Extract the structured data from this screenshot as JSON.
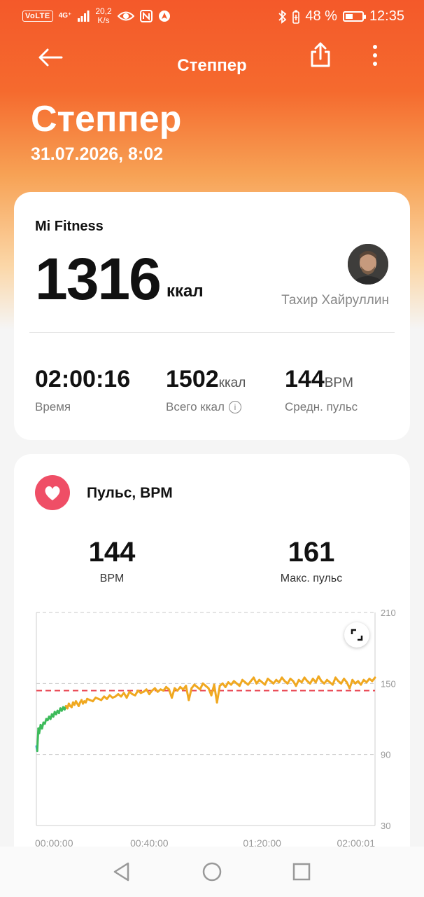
{
  "status_bar": {
    "volte": "VoLTE",
    "net_type": "4G⁺",
    "speed_value": "20,2",
    "speed_unit": "K/s",
    "battery_percent": "48 %",
    "battery_level": 0.48,
    "time": "12:35"
  },
  "app_bar": {
    "title": "Степпер"
  },
  "header": {
    "title": "Степпер",
    "date": "31.07.2026, 8:02"
  },
  "summary": {
    "source": "Mi Fitness",
    "calories": "1316",
    "calories_unit": "ккал",
    "user_name": "Тахир Хайруллин",
    "stats": [
      {
        "value": "02:00:16",
        "unit": "",
        "label": "Время"
      },
      {
        "value": "1502",
        "unit": "ккал",
        "label": "Всего ккал"
      },
      {
        "value": "144",
        "unit": "BPM",
        "label": "Средн. пульс"
      }
    ]
  },
  "pulse": {
    "title": "Пульс, BPM",
    "avg_value": "144",
    "avg_label": "BPM",
    "max_value": "161",
    "max_label": "Макс. пульс"
  },
  "colors": {
    "accent": "#f4592a",
    "heart": "#ef4e66",
    "line_blue": "#3fa9e0",
    "line_green": "#3dbb5a",
    "line_orange": "#f0a820",
    "avg_line": "#e8404c"
  },
  "chart_data": {
    "type": "line",
    "title": "Пульс, BPM",
    "xlabel": "",
    "ylabel": "",
    "x_ticks": [
      "00:00:00",
      "00:40:00",
      "01:20:00",
      "02:00:01"
    ],
    "y_ticks": [
      30,
      90,
      150,
      210
    ],
    "xlim": [
      0,
      120
    ],
    "ylim": [
      30,
      210
    ],
    "avg_line": 144,
    "grid": true,
    "series": [
      {
        "x": [
          0,
          0.3,
          0.7,
          1,
          1.5,
          2,
          2.5,
          3,
          3.5,
          4,
          4.5,
          5,
          5.5,
          6,
          6.5,
          7,
          7.5,
          8,
          8.5,
          9,
          9.5,
          10,
          10.5,
          11,
          11.5,
          12,
          12.5,
          13,
          13.5,
          14,
          14.5,
          15,
          15.5,
          16,
          16.5,
          17,
          17.5,
          18,
          19,
          20,
          21,
          22,
          23,
          24,
          25,
          26,
          27,
          28,
          29,
          30,
          31,
          32,
          33,
          34,
          35,
          36,
          37,
          38,
          39,
          40,
          41,
          42,
          43,
          44,
          45,
          46,
          47,
          48,
          49,
          50,
          51,
          52,
          53,
          54,
          55,
          56,
          57,
          58,
          59,
          60,
          61,
          62,
          63,
          64,
          65,
          66,
          67,
          68,
          69,
          70,
          71,
          72,
          73,
          74,
          75,
          76,
          77,
          78,
          79,
          80,
          81,
          82,
          83,
          84,
          85,
          86,
          87,
          88,
          89,
          90,
          91,
          92,
          93,
          94,
          95,
          96,
          97,
          98,
          99,
          100,
          101,
          102,
          103,
          104,
          105,
          106,
          107,
          108,
          109,
          110,
          111,
          112,
          113,
          114,
          115,
          116,
          117,
          118,
          119,
          120
        ],
        "y": [
          97,
          93,
          112,
          108,
          115,
          112,
          117,
          116,
          120,
          119,
          122,
          120,
          124,
          122,
          126,
          124,
          127,
          125,
          129,
          127,
          130,
          128,
          131,
          129,
          133,
          131,
          130,
          134,
          132,
          135,
          133,
          131,
          134,
          136,
          133,
          135,
          134,
          137,
          136,
          135,
          138,
          137,
          136,
          139,
          137,
          140,
          138,
          139,
          141,
          139,
          142,
          138,
          143,
          141,
          140,
          144,
          142,
          143,
          145,
          141,
          144,
          146,
          143,
          145,
          144,
          147,
          145,
          138,
          146,
          144,
          147,
          145,
          148,
          136,
          146,
          149,
          147,
          145,
          150,
          148,
          146,
          140,
          149,
          134,
          148,
          150,
          147,
          151,
          149,
          152,
          150,
          148,
          153,
          151,
          149,
          152,
          155,
          150,
          153,
          151,
          149,
          154,
          152,
          150,
          153,
          151,
          155,
          152,
          150,
          154,
          152,
          148,
          153,
          151,
          155,
          152,
          150,
          154,
          151,
          156,
          152,
          150,
          153,
          151,
          149,
          155,
          152,
          150,
          154,
          151,
          146,
          153,
          150,
          152,
          149,
          153,
          151,
          154,
          152,
          155
        ]
      }
    ]
  }
}
